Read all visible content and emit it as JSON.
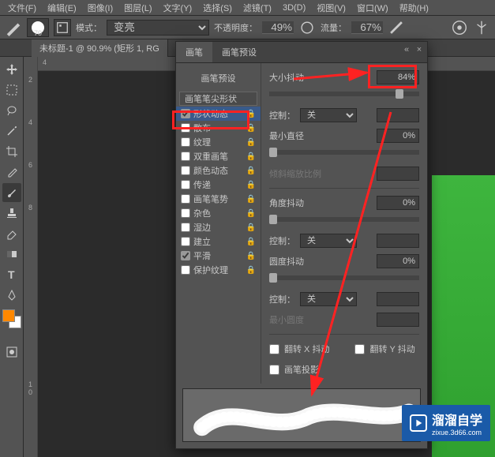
{
  "menu": [
    "文件(F)",
    "编辑(E)",
    "图像(I)",
    "图层(L)",
    "文字(Y)",
    "选择(S)",
    "滤镜(T)",
    "3D(D)",
    "视图(V)",
    "窗口(W)",
    "帮助(H)"
  ],
  "options": {
    "brush_size": "70",
    "mode_label": "模式：",
    "mode_value": "变亮",
    "opacity_label": "不透明度：",
    "opacity_value": "49%",
    "flow_label": "流量：",
    "flow_value": "67%"
  },
  "doc_tab": "未标题-1 @ 90.9% (矩形 1, RG",
  "panel": {
    "tabs": [
      "画笔",
      "画笔预设"
    ],
    "preset_btn": "画笔预设",
    "groups": [
      {
        "label": "画笔笔尖形状",
        "checked": false,
        "lock": false,
        "tip": true
      },
      {
        "label": "形状动态",
        "checked": true,
        "lock": true,
        "hilite": true
      },
      {
        "label": "散布",
        "checked": false,
        "lock": true
      },
      {
        "label": "纹理",
        "checked": false,
        "lock": true
      },
      {
        "label": "双重画笔",
        "checked": false,
        "lock": true
      },
      {
        "label": "颜色动态",
        "checked": false,
        "lock": true
      },
      {
        "label": "传递",
        "checked": false,
        "lock": true
      },
      {
        "label": "画笔笔势",
        "checked": false,
        "lock": true
      },
      {
        "label": "杂色",
        "checked": false,
        "lock": true
      },
      {
        "label": "湿边",
        "checked": false,
        "lock": true
      },
      {
        "label": "建立",
        "checked": false,
        "lock": true
      },
      {
        "label": "平滑",
        "checked": true,
        "lock": true
      },
      {
        "label": "保护纹理",
        "checked": false,
        "lock": true
      }
    ],
    "size_jitter_label": "大小抖动",
    "size_jitter_value": "84%",
    "control_label": "控制：",
    "control_value": "关",
    "min_diam_label": "最小直径",
    "min_diam_value": "0%",
    "tilt_label": "倾斜缩放比例",
    "angle_jitter_label": "角度抖动",
    "angle_jitter_value": "0%",
    "round_jitter_label": "圆度抖动",
    "round_jitter_value": "0%",
    "min_round_label": "最小圆度",
    "flipx": "翻转 X 抖动",
    "flipy": "翻转 Y 抖动",
    "proj": "画笔投影"
  },
  "ruler_v": [
    "2",
    "4",
    "6",
    "8",
    "1",
    "0"
  ],
  "watermark": {
    "name": "溜溜自学",
    "url": "zixue.3d66.com"
  },
  "chart_data": null
}
